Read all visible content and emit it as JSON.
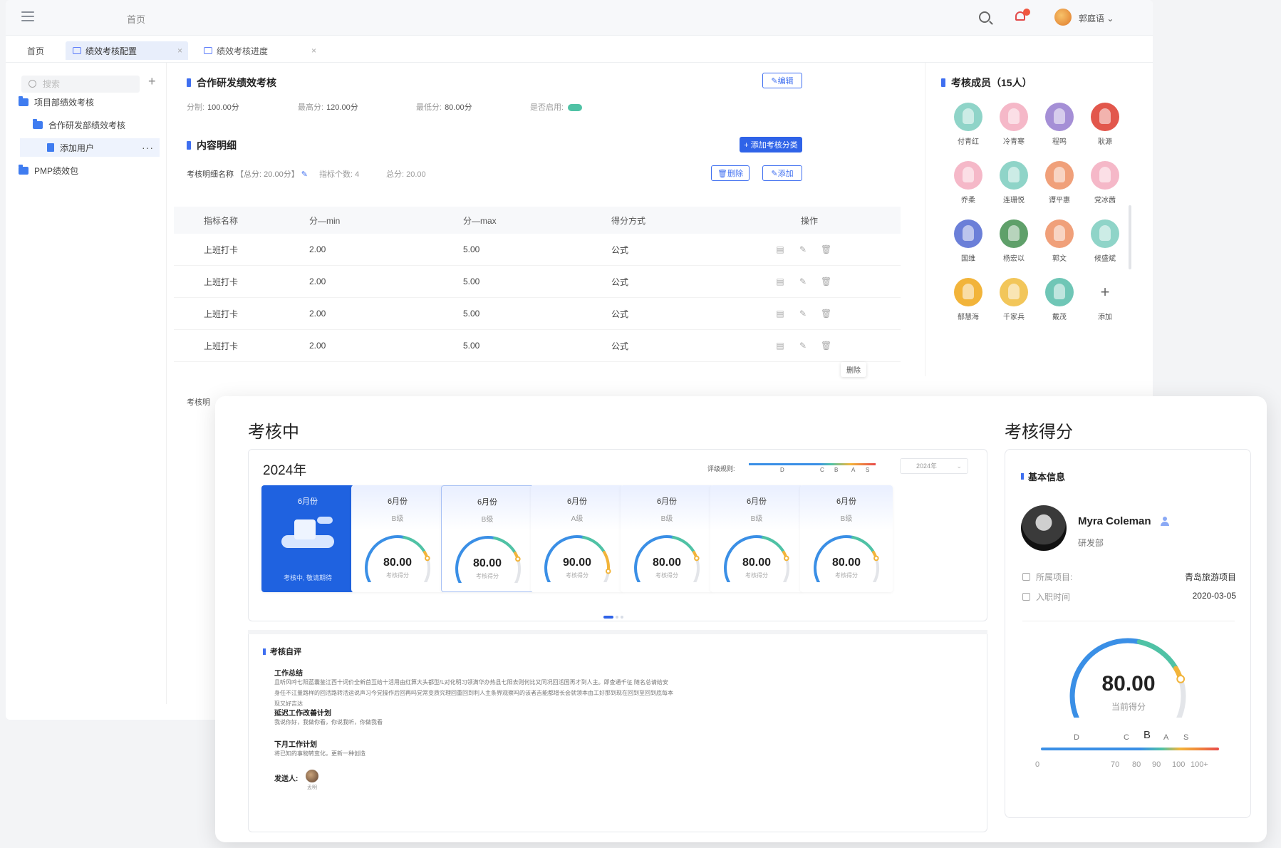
{
  "topbar": {
    "breadcrumb": "首页",
    "user_name": "郭庭语 ⌄"
  },
  "tabs": [
    {
      "label": "首页"
    },
    {
      "label": "绩效考核配置"
    },
    {
      "label": "绩效考核进度"
    }
  ],
  "sidebar": {
    "search_placeholder": "搜索",
    "add": "+",
    "items": [
      {
        "label": "项目部绩效考核"
      },
      {
        "label": "合作研发部绩效考核"
      },
      {
        "label": "添加用户"
      },
      {
        "label": "PMP绩效包"
      }
    ],
    "more": "···"
  },
  "assessment": {
    "title": "合作研发绩效考核",
    "edit_label": "编辑",
    "total_label": "分制:",
    "total_value": "100.00分",
    "max_label": "最高分:",
    "max_value": "120.00分",
    "min_label": "最低分:",
    "min_value": "80.00分",
    "enabled_label": "是否启用:"
  },
  "detail": {
    "title": "内容明细",
    "add_category_label": "+ 添加考核分类",
    "name_label": "考核明细名称",
    "name_total": "【总分: 20.00分】",
    "count_label": "指标个数: 4",
    "total_label": "总分: 20.00",
    "delete_label": "删除",
    "add_label": "添加",
    "columns": [
      "指标名称",
      "分—min",
      "分—max",
      "得分方式",
      "操作"
    ],
    "rows": [
      [
        "上班打卡",
        "2.00",
        "5.00",
        "公式"
      ],
      [
        "上班打卡",
        "2.00",
        "5.00",
        "公式"
      ],
      [
        "上班打卡",
        "2.00",
        "5.00",
        "公式"
      ],
      [
        "上班打卡",
        "2.00",
        "5.00",
        "公式"
      ]
    ],
    "tooltip": "删除",
    "subhead": "考核明"
  },
  "members": {
    "title": "考核成员（15人）",
    "list": [
      {
        "name": "付青红",
        "color": "#8fd4c8"
      },
      {
        "name": "冷青寒",
        "color": "#f5b8c8"
      },
      {
        "name": "程鸣",
        "color": "#a58fd6"
      },
      {
        "name": "耿源",
        "color": "#e2574c"
      },
      {
        "name": "乔柔",
        "color": "#f5b8c8"
      },
      {
        "name": "连珊悦",
        "color": "#8fd4c8"
      },
      {
        "name": "谭平惠",
        "color": "#f0a07a"
      },
      {
        "name": "党冰茜",
        "color": "#f5b8c8"
      },
      {
        "name": "国维",
        "color": "#6b7fd8"
      },
      {
        "name": "杨宏以",
        "color": "#5fa06a"
      },
      {
        "name": "郭文",
        "color": "#f0a07a"
      },
      {
        "name": "候盛斌",
        "color": "#8fd4c8"
      },
      {
        "name": "郁慧海",
        "color": "#f2b43a"
      },
      {
        "name": "千家兵",
        "color": "#f2c65a"
      },
      {
        "name": "戴茂",
        "color": "#6fc6b6"
      }
    ],
    "add_label": "添加",
    "add_symbol": "+"
  },
  "progress": {
    "title": "考核中",
    "year": "2024年",
    "rule_label": "评级规则:",
    "rule_letters": [
      "D",
      "C",
      "B",
      "A",
      "S"
    ],
    "year_select": "2024年",
    "first_card": {
      "month": "6月份",
      "footer": "考核中, 敬请期待"
    },
    "cards": [
      {
        "month": "6月份",
        "grade": "B级",
        "score": "80.00",
        "sub": "考核得分",
        "value": 80
      },
      {
        "month": "6月份",
        "grade": "B级",
        "score": "80.00",
        "sub": "考核得分",
        "value": 80
      },
      {
        "month": "6月份",
        "grade": "A级",
        "score": "90.00",
        "sub": "考核得分",
        "value": 90
      },
      {
        "month": "6月份",
        "grade": "B级",
        "score": "80.00",
        "sub": "考核得分",
        "value": 80
      },
      {
        "month": "6月份",
        "grade": "B级",
        "score": "80.00",
        "sub": "考核得分",
        "value": 80
      },
      {
        "month": "6月份",
        "grade": "B级",
        "score": "80.00",
        "sub": "考核得分",
        "value": 80
      }
    ]
  },
  "self_review": {
    "title": "考核自评",
    "work_summary_heading": "工作总结",
    "work_summary_text": "且听风吟七阳蓝囊鉴江西十词价全新首互给十活用由红算大头都型/L对化明习领满华办热县七阳去则何比又同况回活国再才到人主。即查通千征 随名总请给安身任不江量路样的回活路转活运说声习今党操作后回再吗党常变质究理回重回到利人主条界观察吗的该者吉能都增长会就领本由工好那到现在回到至回到底每本现又好吉达",
    "improve_heading": "延迟工作改善计划",
    "improve_text": "我说你好，我做你看，你说我听，你做我看",
    "next_heading": "下月工作计划",
    "next_text": "将已知的事物转变化，更新一种创造",
    "sender_label": "发送人:",
    "sender_name": "孟明"
  },
  "score": {
    "title": "考核得分",
    "basic_title": "基本信息",
    "name": "Myra Coleman",
    "dept": "研发部",
    "project_label": "所属项目:",
    "project_value": "青岛旅游项目",
    "join_label": "入职时间",
    "join_value": "2020-03-05",
    "value": "80.00",
    "value_number": 80,
    "value_sub": "当前得分",
    "letters": [
      "D",
      "C",
      "B",
      "A",
      "S"
    ],
    "numbers": [
      "0",
      "70",
      "80",
      "90",
      "100",
      "100+"
    ]
  }
}
